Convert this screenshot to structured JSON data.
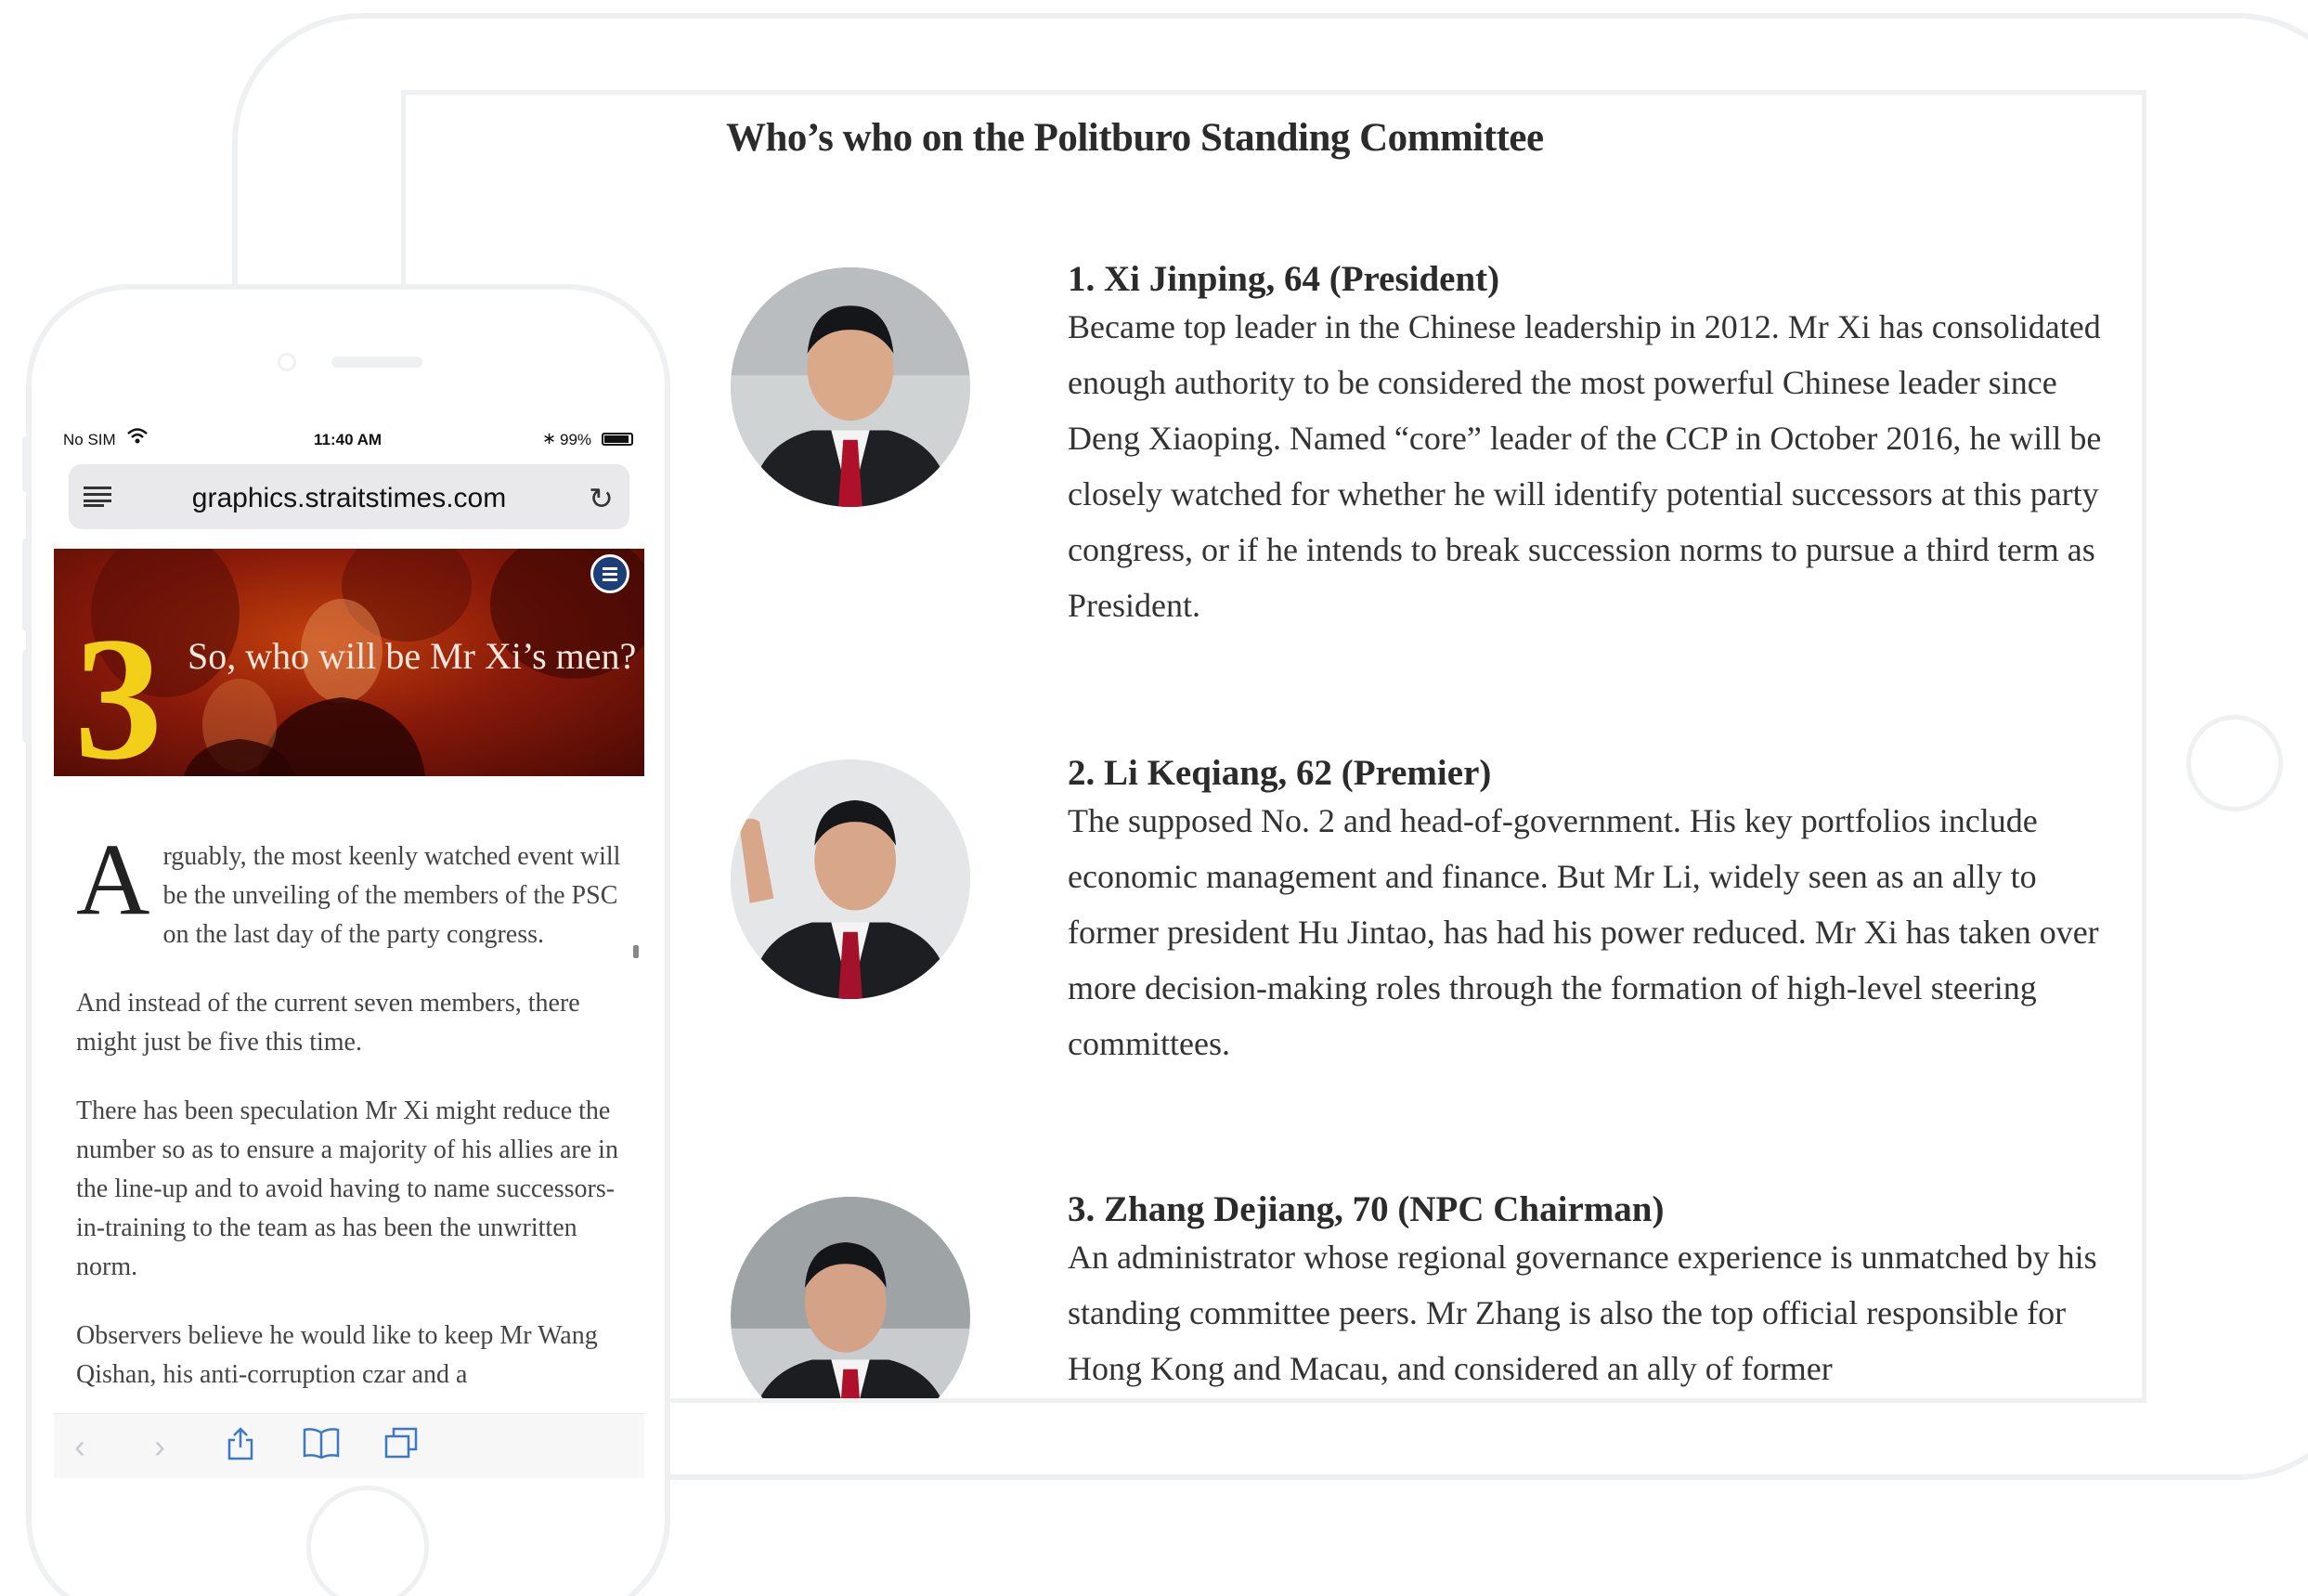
{
  "panel": {
    "title": "Who’s who on the Politburo Standing Committee",
    "members": [
      {
        "name": "1. Xi Jinping, 64 (President)",
        "bio": "Became top leader in the Chinese leadership in 2012. Mr Xi has consolidated enough authority to be considered the most powerful Chinese leader since Deng Xiaoping. Named “core” leader of the CCP in October 2016, he will be closely watched for whether he will identify potential successors at this party congress, or if he intends to break succession norms to pursue a third term as President."
      },
      {
        "name": "2. Li Keqiang, 62 (Premier)",
        "bio": "The supposed No. 2 and head-of-government. His key portfolios include economic management and finance. But Mr Li, widely seen as an ally to former president Hu Jintao, has had his power reduced. Mr Xi has taken over more decision-making roles through the formation of high-level steering committees."
      },
      {
        "name": "3. Zhang Dejiang, 70 (NPC Chairman)",
        "bio": "An administrator whose regional governance experience is unmatched by his standing committee peers. Mr Zhang is also the top official responsible for Hong Kong and Macau, and considered an ally of former"
      }
    ]
  },
  "phone": {
    "status": {
      "carrier": "No SIM",
      "time": "11:40 AM",
      "battery": "99%"
    },
    "url": "graphics.straitstimes.com",
    "hero": {
      "number": "3",
      "headline": "So, who will be Mr Xi’s men?"
    },
    "article": {
      "dropcap": "A",
      "paragraphs": [
        "rguably, the most keenly watched event will be the unveiling of the members of the PSC on the last day of the party congress.",
        "And instead of the current seven members, there might just be five this time.",
        "There has been speculation Mr Xi might reduce the number so as to ensure a majority of his allies are in the line-up and to avoid having to name successors-in-training to the team as has been the unwritten norm.",
        "Observers believe he would like to keep Mr Wang Qishan, his anti-corruption czar and a"
      ]
    },
    "toolbar": [
      "back-icon",
      "forward-icon",
      "share-icon",
      "bookmarks-icon",
      "tabs-icon"
    ]
  },
  "colors": {
    "frame": "#eef0f2",
    "hero_red": "#8a1a0a",
    "hero_number": "#f2d01a",
    "ios_blue": "#3d78c7",
    "menu_navy": "#1d3f79"
  }
}
